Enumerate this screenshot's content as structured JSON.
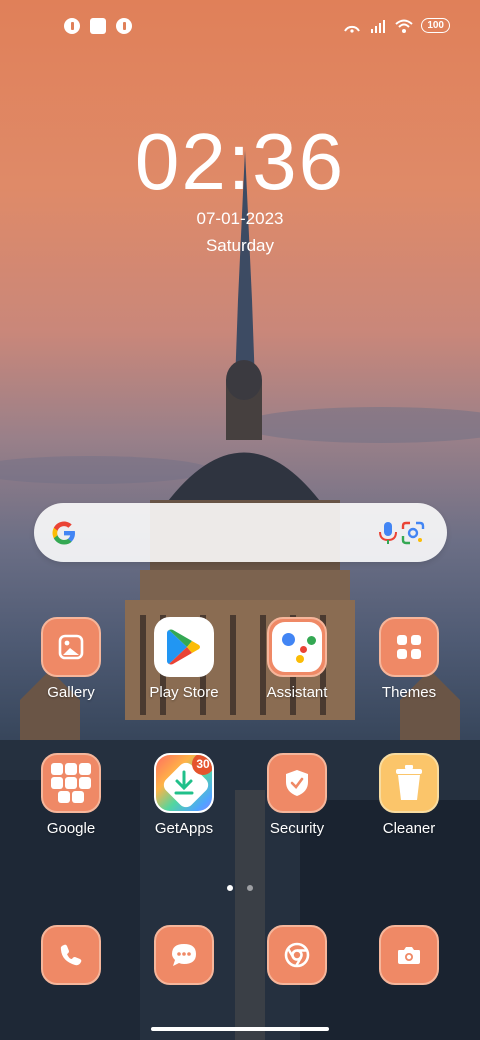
{
  "status_bar": {
    "battery": "100"
  },
  "lockclock": {
    "time": "02:36",
    "date": "07-01-2023",
    "day": "Saturday"
  },
  "search": {
    "provider": "google"
  },
  "apps": [
    {
      "label": "Gallery",
      "icon": "gallery-icon"
    },
    {
      "label": "Play Store",
      "icon": "play-store-icon"
    },
    {
      "label": "Assistant",
      "icon": "assistant-icon"
    },
    {
      "label": "Themes",
      "icon": "themes-icon"
    },
    {
      "label": "Google",
      "icon": "google-folder-icon"
    },
    {
      "label": "GetApps",
      "icon": "getapps-icon",
      "badge": "30"
    },
    {
      "label": "Security",
      "icon": "security-icon"
    },
    {
      "label": "Cleaner",
      "icon": "cleaner-icon"
    }
  ],
  "dock": [
    {
      "icon": "phone-icon"
    },
    {
      "icon": "messages-icon"
    },
    {
      "icon": "chrome-icon"
    },
    {
      "icon": "camera-icon"
    }
  ],
  "page_indicator": {
    "pages": 2,
    "active": 1
  },
  "colors": {
    "tile": "#ef8966",
    "accent": "#e5542d"
  }
}
